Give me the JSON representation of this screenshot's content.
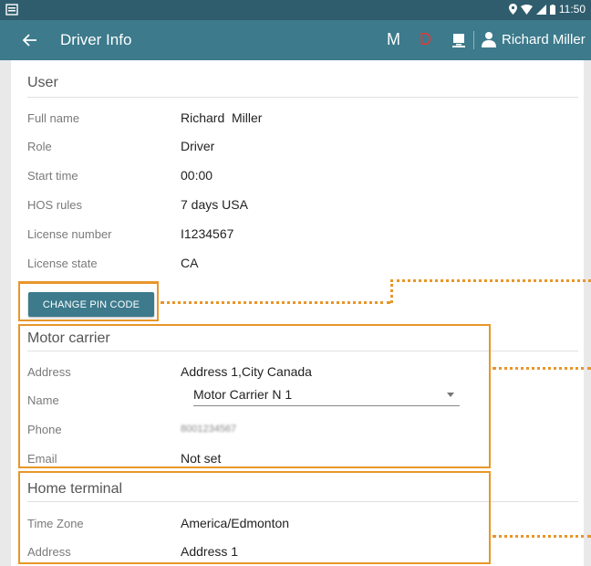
{
  "status_bar": {
    "time": "11:50"
  },
  "app_bar": {
    "title": "Driver Info",
    "m_label": "M",
    "d_label": "D",
    "user_name": "Richard Miller"
  },
  "user_section": {
    "title": "User",
    "fields": [
      {
        "label": "Full name",
        "value": "Richard  Miller"
      },
      {
        "label": "Role",
        "value": "Driver"
      },
      {
        "label": "Start time",
        "value": "00:00"
      },
      {
        "label": "HOS rules",
        "value": "7 days USA"
      },
      {
        "label": "License number",
        "value": "I1234567"
      },
      {
        "label": "License state",
        "value": "CA"
      }
    ],
    "pin_button": "CHANGE PIN CODE"
  },
  "motor_carrier": {
    "title": "Motor carrier",
    "address_label": "Address",
    "address_value": "Address 1,City Canada",
    "name_label": "Name",
    "name_value": "Motor Carrier N 1",
    "phone_label": "Phone",
    "phone_value": "8001234567",
    "email_label": "Email",
    "email_value": "Not set"
  },
  "home_terminal": {
    "title": "Home terminal",
    "timezone_label": "Time Zone",
    "timezone_value": "America/Edmonton",
    "address_label": "Address",
    "address_value": "Address 1"
  },
  "colors": {
    "header": "#3c7a8c",
    "status_bar": "#2f5d6e",
    "highlight": "#e8962a",
    "d_red": "#e53935"
  }
}
